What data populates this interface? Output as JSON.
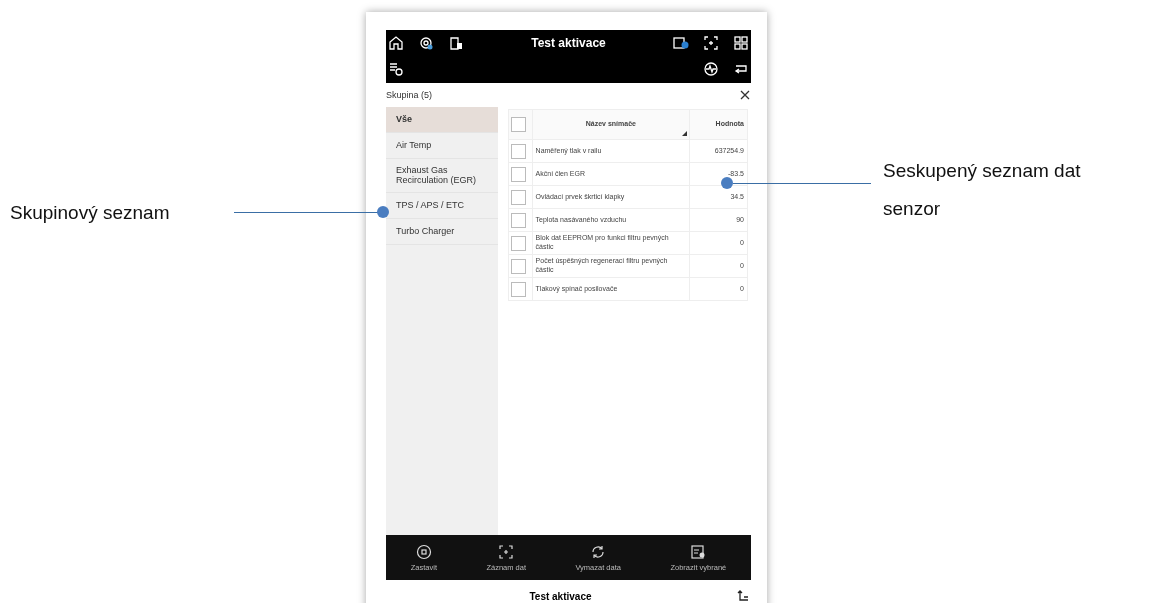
{
  "header": {
    "title": "Test aktivace"
  },
  "group_panel": {
    "title": "Skupina (5)"
  },
  "groups": [
    {
      "label": "Vše",
      "selected": true
    },
    {
      "label": "Air Temp",
      "selected": false
    },
    {
      "label": "Exhaust Gas Recirculation (EGR)",
      "selected": false
    },
    {
      "label": "TPS / APS / ETC",
      "selected": false
    },
    {
      "label": "Turbo Charger",
      "selected": false
    }
  ],
  "table": {
    "columns": [
      "Název snímače",
      "Hodnota"
    ],
    "header_checked": false,
    "rows": [
      {
        "name": "Naměřený tlak v railu",
        "value": "637254.9",
        "checked": false
      },
      {
        "name": "Akční člen EGR",
        "value": "-83.5",
        "checked": false
      },
      {
        "name": "Ovládací prvek škrticí klapky",
        "value": "34.5",
        "checked": false
      },
      {
        "name": "Teplota nasávaného vzduchu",
        "value": "90",
        "checked": false
      },
      {
        "name": "Blok dat EEPROM pro funkci filtru pevných částic",
        "value": "0",
        "checked": false
      },
      {
        "name": "Počet úspěšných regenerací filtru pevných částic",
        "value": "0",
        "checked": false
      },
      {
        "name": "Tlakový spínač posilovače",
        "value": "0",
        "checked": false
      }
    ]
  },
  "bottom_bar": [
    {
      "kind": "stop",
      "label": "Zastavit"
    },
    {
      "kind": "record",
      "label": "Záznam dat"
    },
    {
      "kind": "refresh",
      "label": "Vymazat data"
    },
    {
      "kind": "show",
      "label": "Zobrazit vybrané"
    }
  ],
  "footer": {
    "title": "Test aktivace"
  },
  "callouts": [
    {
      "kind": "left",
      "text": "Skupinový seznam"
    },
    {
      "kind": "right",
      "text": "Seskupený seznam dat senzor"
    }
  ]
}
